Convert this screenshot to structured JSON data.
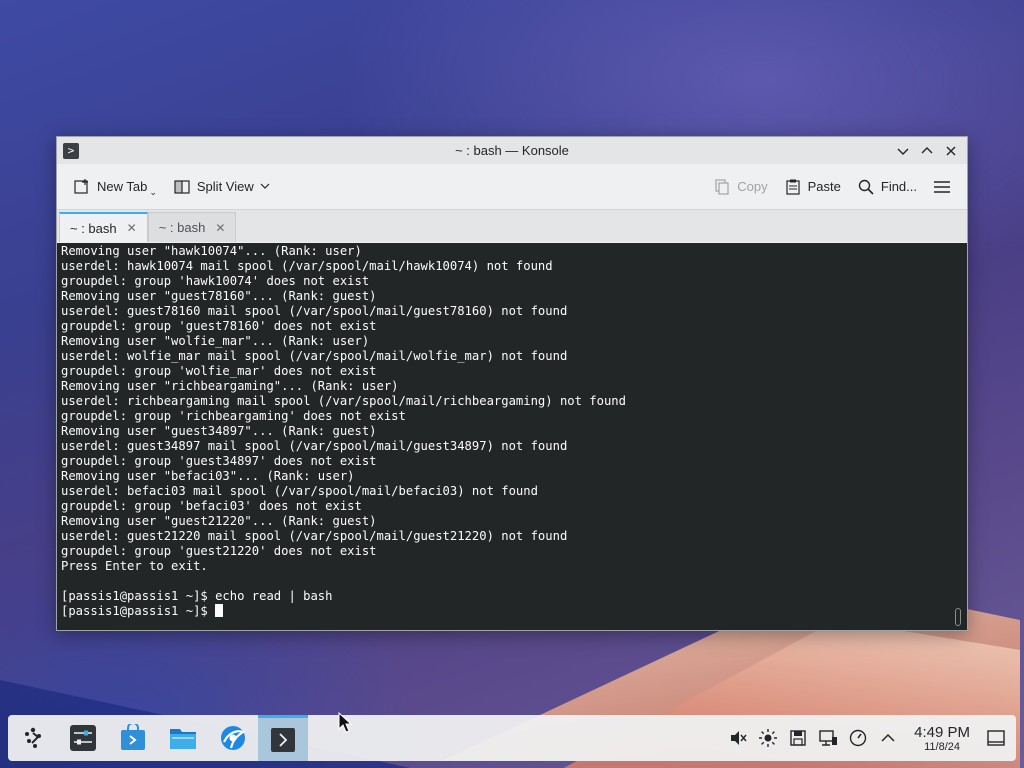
{
  "window": {
    "title": "~ : bash — Konsole",
    "app_icon_glyph": ">"
  },
  "toolbar": {
    "new_tab": "New Tab",
    "split_view": "Split View",
    "copy": "Copy",
    "paste": "Paste",
    "find": "Find..."
  },
  "tabs": [
    {
      "label": "~ : bash",
      "active": true
    },
    {
      "label": "~ : bash",
      "active": false
    }
  ],
  "terminal": {
    "lines": [
      "Removing user \"hawk10074\"... (Rank: user)",
      "userdel: hawk10074 mail spool (/var/spool/mail/hawk10074) not found",
      "groupdel: group 'hawk10074' does not exist",
      "Removing user \"guest78160\"... (Rank: guest)",
      "userdel: guest78160 mail spool (/var/spool/mail/guest78160) not found",
      "groupdel: group 'guest78160' does not exist",
      "Removing user \"wolfie_mar\"... (Rank: user)",
      "userdel: wolfie_mar mail spool (/var/spool/mail/wolfie_mar) not found",
      "groupdel: group 'wolfie_mar' does not exist",
      "Removing user \"richbeargaming\"... (Rank: user)",
      "userdel: richbeargaming mail spool (/var/spool/mail/richbeargaming) not found",
      "groupdel: group 'richbeargaming' does not exist",
      "Removing user \"guest34897\"... (Rank: guest)",
      "userdel: guest34897 mail spool (/var/spool/mail/guest34897) not found",
      "groupdel: group 'guest34897' does not exist",
      "Removing user \"befaci03\"... (Rank: user)",
      "userdel: befaci03 mail spool (/var/spool/mail/befaci03) not found",
      "groupdel: group 'befaci03' does not exist",
      "Removing user \"guest21220\"... (Rank: guest)",
      "userdel: guest21220 mail spool (/var/spool/mail/guest21220) not found",
      "groupdel: group 'guest21220' does not exist",
      "Press Enter to exit.",
      "",
      "[passis1@passis1 ~]$ echo read | bash"
    ],
    "prompt": "[passis1@passis1 ~]$ "
  },
  "panel": {
    "tasks": [
      {
        "name": "app-launcher-icon"
      },
      {
        "name": "system-settings-icon"
      },
      {
        "name": "discover-icon"
      },
      {
        "name": "dolphin-icon"
      },
      {
        "name": "browser-icon"
      },
      {
        "name": "konsole-icon",
        "active": true
      }
    ],
    "clock": {
      "time": "4:49 PM",
      "date": "11/8/24"
    }
  },
  "colors": {
    "accent": "#3daee9",
    "terminal_bg": "#232627",
    "terminal_fg": "#fcfcfc"
  }
}
